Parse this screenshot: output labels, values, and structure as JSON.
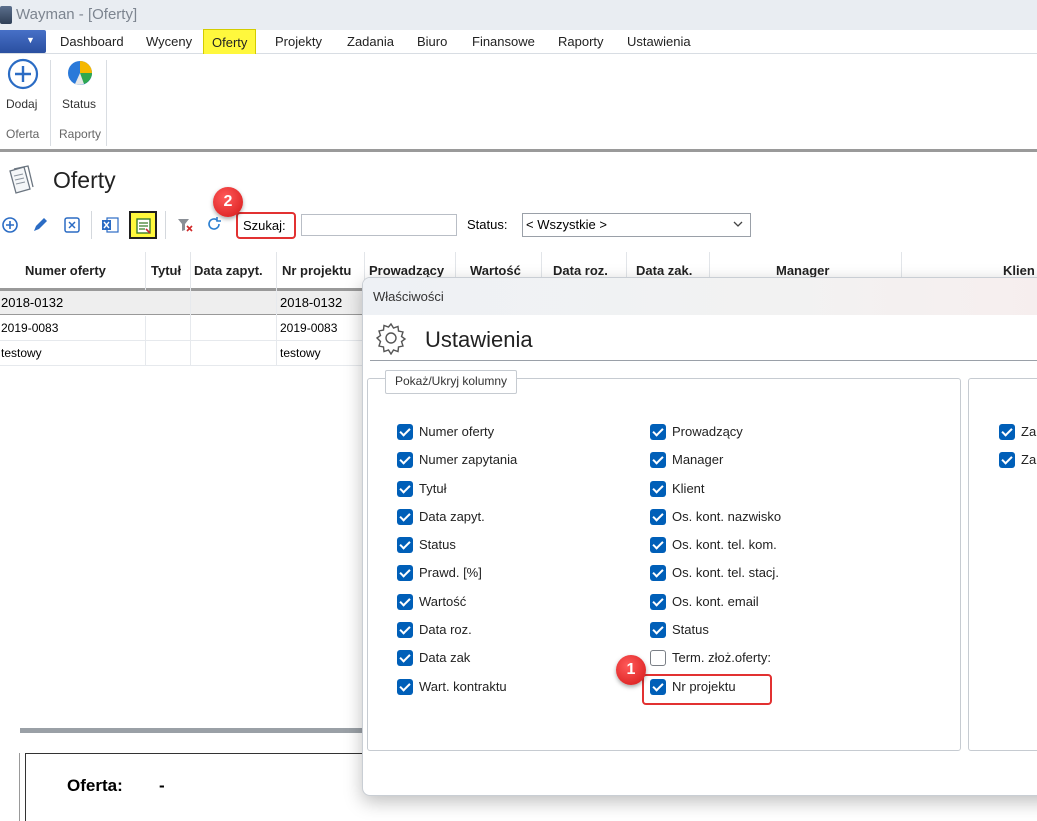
{
  "window": {
    "title": "Wayman - [Oferty]"
  },
  "menu": {
    "items": [
      "Dashboard",
      "Wyceny",
      "Oferty",
      "Projekty",
      "Zadania",
      "Biuro",
      "Finansowe",
      "Raporty",
      "Ustawienia"
    ],
    "active": "Oferty"
  },
  "ribbon": {
    "add_label": "Dodaj",
    "status_label": "Status",
    "group_oferta": "Oferta",
    "group_raporty": "Raporty"
  },
  "page": {
    "title": "Oferty"
  },
  "toolbar": {
    "search_label": "Szukaj:",
    "search_value": "",
    "status_label": "Status:",
    "status_value": "< Wszystkie >"
  },
  "annotations": {
    "badge_1": "1",
    "badge_2": "2"
  },
  "grid": {
    "columns": [
      "Numer oferty",
      "Tytuł",
      "Data zapyt.",
      "Nr projektu",
      "Prowadzący",
      "Wartość",
      "Data roz.",
      "Data zak.",
      "Manager",
      "Klien"
    ],
    "rows": [
      {
        "numer": "2018-0132",
        "tytul": "",
        "data": "",
        "nr_projektu": "2018-0132"
      },
      {
        "numer": "2019-0083",
        "tytul": "",
        "data": "",
        "nr_projektu": "2019-0083"
      },
      {
        "numer": "testowy",
        "tytul": "",
        "data": "",
        "nr_projektu": "testowy"
      }
    ]
  },
  "details": {
    "oferta_label": "Oferta:",
    "oferta_value": "-"
  },
  "dialog": {
    "title": "Właściwości",
    "heading": "Ustawienia",
    "group_label": "Pokaż/Ukryj kolumny",
    "left_column": [
      {
        "label": "Numer oferty",
        "checked": true
      },
      {
        "label": "Numer zapytania",
        "checked": true
      },
      {
        "label": "Tytuł",
        "checked": true
      },
      {
        "label": "Data zapyt.",
        "checked": true
      },
      {
        "label": "Status",
        "checked": true
      },
      {
        "label": "Prawd. [%]",
        "checked": true
      },
      {
        "label": "Wartość",
        "checked": true
      },
      {
        "label": "Data roz.",
        "checked": true
      },
      {
        "label": "Data zak",
        "checked": true
      },
      {
        "label": "Wart. kontraktu",
        "checked": true
      }
    ],
    "right_column": [
      {
        "label": "Prowadzący",
        "checked": true
      },
      {
        "label": "Manager",
        "checked": true
      },
      {
        "label": "Klient",
        "checked": true
      },
      {
        "label": "Os. kont. nazwisko",
        "checked": true
      },
      {
        "label": "Os. kont. tel. kom.",
        "checked": true
      },
      {
        "label": "Os. kont. tel. stacj.",
        "checked": true
      },
      {
        "label": "Os. kont. email",
        "checked": true
      },
      {
        "label": "Status",
        "checked": true
      },
      {
        "label": "Term. złoż.oferty:",
        "checked": false
      },
      {
        "label": "Nr projektu",
        "checked": true
      }
    ],
    "third_column": [
      {
        "label": "Za",
        "checked": true
      },
      {
        "label": "Za",
        "checked": true
      }
    ]
  }
}
